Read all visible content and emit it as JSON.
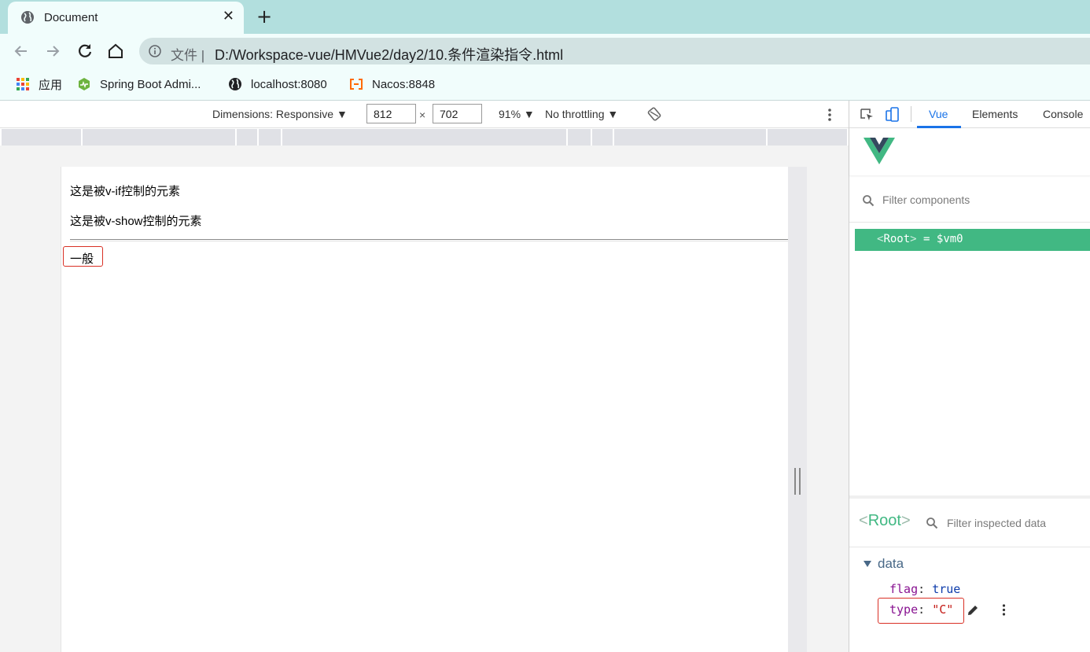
{
  "browser": {
    "tab_title": "Document",
    "tab_close_glyph": "✕",
    "new_tab_glyph": "+",
    "url_scheme": "文件 |",
    "url": "D:/Workspace-vue/HMVue2/day2/10.条件渲染指令.html",
    "icons": [
      "globe-icon",
      "back-icon",
      "forward-icon",
      "reload-icon",
      "home-icon",
      "info-icon"
    ]
  },
  "bookmarks": [
    {
      "label": "应用",
      "icon": "apps-grid-icon"
    },
    {
      "label": "Spring Boot Admi...",
      "icon": "spring-boot-admin-icon"
    },
    {
      "label": "localhost:8080",
      "icon": "globe-icon"
    },
    {
      "label": "Nacos:8848",
      "icon": "nacos-icon"
    }
  ],
  "device_toolbar": {
    "dimensions_label": "Dimensions: Responsive ▼",
    "width": "812",
    "times": "×",
    "height": "702",
    "zoom": "91% ▼",
    "throttling": "No throttling ▼"
  },
  "page": {
    "line1": "这是被v-if控制的元素",
    "line2": "这是被v-show控制的元素",
    "type_text": "一般"
  },
  "devtools": {
    "tabs": [
      "Vue",
      "Elements",
      "Console"
    ],
    "active_tab": "Vue",
    "filter_components_placeholder": "Filter components",
    "root_component": "Root",
    "root_suffix": "= $vm0",
    "inspected_name": "Root",
    "filter_data_placeholder": "Filter inspected data",
    "data_section_title": "data",
    "props": [
      {
        "key": "flag",
        "value": "true",
        "kind": "boolean"
      },
      {
        "key": "type",
        "value": "\"C\"",
        "kind": "string"
      }
    ],
    "colors": {
      "vue_green": "#41b883",
      "vue_dark": "#34495e",
      "accent_blue": "#1a73e8",
      "highlight_red": "#d93025"
    }
  }
}
